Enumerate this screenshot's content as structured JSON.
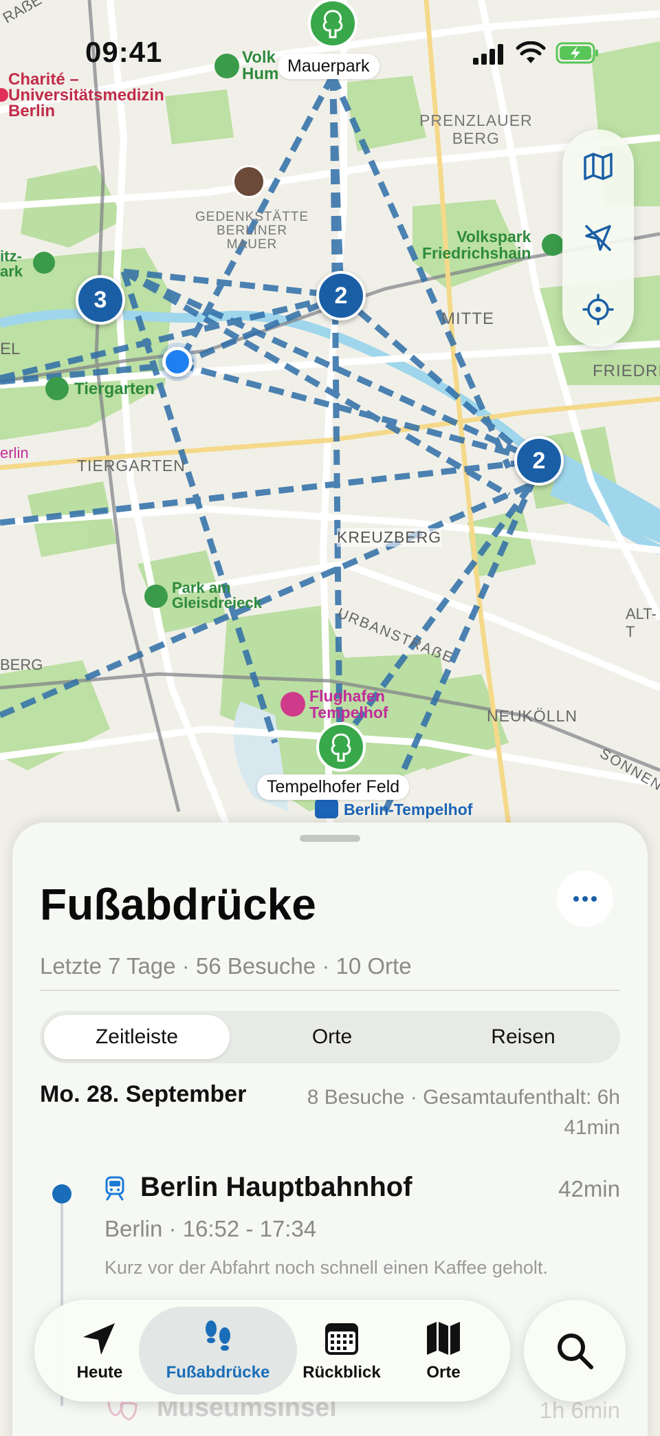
{
  "status": {
    "time": "09:41"
  },
  "map": {
    "labels": {
      "charite": "Charité –\nUniversitätsmedizin\nBerlin",
      "volkspark_hum": "Volk\nHum",
      "prenzlauer": "PRENZLAUER\nBERG",
      "gedenk": "GEDENKSTÄTTE\nBERLINER\nMAUER",
      "volkspark_fh": "Volkspark\nFriedrichshain",
      "mitte": "MITTE",
      "friedric": "FRIEDRIC",
      "tiergarten_park": "Tiergarten",
      "tiergarten": "TIERGARTEN",
      "erlin": "erlin",
      "kreuzberg": "KREUZBERG",
      "urbanstrasse": "URBANSTRAẞE",
      "park_gleis": "Park am\nGleisdreieck",
      "alt": "ALT-T",
      "berg": "BERG",
      "flughafen": "Flughafen\nTempelhof",
      "neukolln": "NEUKÖLLN",
      "sonnen": "SONNEN",
      "berlin_tempelhof": "Berlin-Tempelhof",
      "itz_park": "itz-\nark",
      "el": "EL",
      "strasse_top": "RAẞE"
    },
    "pins": {
      "mauerpark": "Mauerpark",
      "tempelhofer": "Tempelhofer Feld"
    },
    "clusters": {
      "c1": "3",
      "c2": "2",
      "c3": "2"
    },
    "route_color": "#2f6ea8",
    "controls": [
      "map-icon",
      "location-arrow-slash-icon",
      "crosshair-icon"
    ]
  },
  "sheet": {
    "title": "Fußabdrücke",
    "subtitle": "Letzte 7 Tage · 56 Besuche · 10 Orte",
    "segments": [
      "Zeitleiste",
      "Orte",
      "Reisen"
    ],
    "selected_segment": "Zeitleiste",
    "day": {
      "label": "Mo. 28. September",
      "stats": "8 Besuche · Gesamtaufenthalt: 6h 41min"
    },
    "entries": [
      {
        "icon": "train-icon",
        "name": "Berlin Hauptbahnhof",
        "duration": "42min",
        "meta": "Berlin · 16:52 - 17:34",
        "note": "Kurz vor der Abfahrt noch schnell einen Kaffee geholt."
      },
      {
        "icon": "masks-icon",
        "name": "Museumsinsel",
        "duration": "1h 6min"
      }
    ]
  },
  "tabbar": {
    "tabs": [
      {
        "label": "Heute",
        "icon": "location-arrow-icon"
      },
      {
        "label": "Fußabdrücke",
        "icon": "footprints-icon"
      },
      {
        "label": "Rückblick",
        "icon": "calendar-icon"
      },
      {
        "label": "Orte",
        "icon": "map-icon"
      }
    ],
    "active": "Fußabdrücke",
    "accent": "#1a6db8"
  }
}
